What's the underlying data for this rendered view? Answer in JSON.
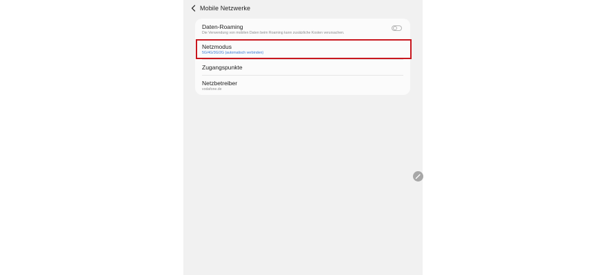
{
  "header": {
    "title": "Mobile Netzwerke",
    "back_icon": "chevron-left-icon"
  },
  "settings": {
    "data_roaming": {
      "title": "Daten-Roaming",
      "subtitle": "Die Verwendung von mobilen Daten beim Roaming kann zusätzliche Kosten verursachen.",
      "toggle_state": "off"
    },
    "network_mode": {
      "title": "Netzmodus",
      "value": "5G/4G/3G/2G (automatisch verbinden)"
    },
    "access_points": {
      "title": "Zugangspunkte"
    },
    "network_operator": {
      "title": "Netzbetreiber",
      "value": "vodafone.de"
    }
  },
  "floating_button": {
    "icon": "pencil-icon"
  },
  "colors": {
    "highlight": "#c8161d",
    "accent_value": "#3a7bd5",
    "background": "#f1f1f1",
    "card": "#fbfbfb"
  }
}
